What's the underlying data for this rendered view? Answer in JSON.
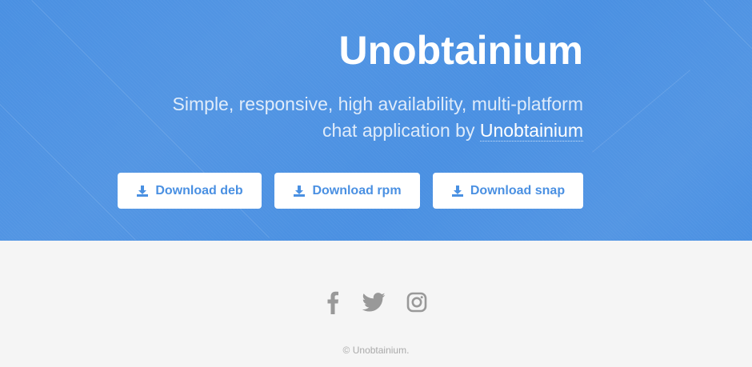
{
  "hero": {
    "title": "Unobtainium",
    "subtitle_text": "Simple, responsive, high availability, multi-platform chat application by ",
    "subtitle_link": "Unobtainium"
  },
  "downloads": [
    {
      "label": "Download deb",
      "icon": "download-icon"
    },
    {
      "label": "Download rpm",
      "icon": "download-icon"
    },
    {
      "label": "Download snap",
      "icon": "download-icon"
    }
  ],
  "social": [
    {
      "icon": "facebook-icon"
    },
    {
      "icon": "twitter-icon"
    },
    {
      "icon": "instagram-icon"
    }
  ],
  "footer": {
    "copyright": "© Unobtainium."
  },
  "colors": {
    "hero_background": "#4a90e2",
    "button_text": "#4a90e2",
    "footer_background": "#f5f5f5",
    "social_icon": "#999999",
    "copyright_text": "#aaaaaa"
  }
}
